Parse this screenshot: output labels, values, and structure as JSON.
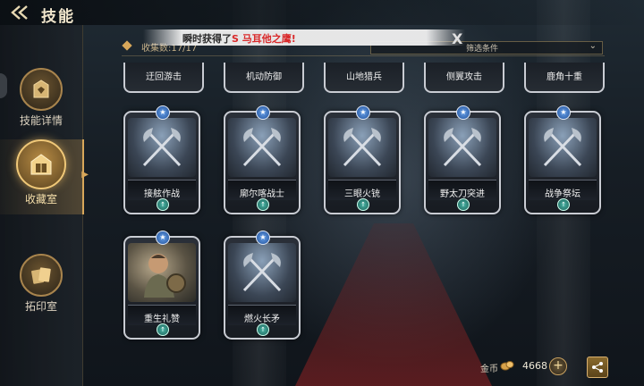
{
  "header": {
    "title": "技能"
  },
  "nav": [
    {
      "label": "技能详情",
      "icon": "skill-details-icon",
      "active": false
    },
    {
      "label": "收藏室",
      "icon": "collection-room-icon",
      "active": true
    },
    {
      "label": "拓印室",
      "icon": "rubbing-room-icon",
      "active": false
    }
  ],
  "collection": {
    "count_text": "收集数:17/17",
    "filter_label": "筛选条件"
  },
  "toast": {
    "prefix": "瞬时获得了",
    "highlight": "S 马耳他之鹰!"
  },
  "top_row_partial": [
    "迂回游击",
    "机动防御",
    "山地猎兵",
    "侧翼攻击",
    "鹿角十重"
  ],
  "cards": [
    {
      "label": "接舷作战",
      "art": "crossed-axes-art"
    },
    {
      "label": "廓尔喀战士",
      "art": "crossed-axes-art"
    },
    {
      "label": "三眼火铳",
      "art": "crossed-axes-art"
    },
    {
      "label": "野太刀突进",
      "art": "crossed-axes-art"
    },
    {
      "label": "战争祭坛",
      "art": "crossed-axes-art"
    },
    {
      "label": "重生礼赞",
      "art": "hero-portrait-art"
    },
    {
      "label": "燃火长矛",
      "art": "crossed-axes-art"
    }
  ],
  "currency": {
    "label": "金币",
    "value": "4668",
    "add": "+"
  },
  "close_symbol": "X",
  "colors": {
    "accent": "#d8a75a",
    "highlight": "#d9292a",
    "card_frame": "#c9ccd3"
  }
}
